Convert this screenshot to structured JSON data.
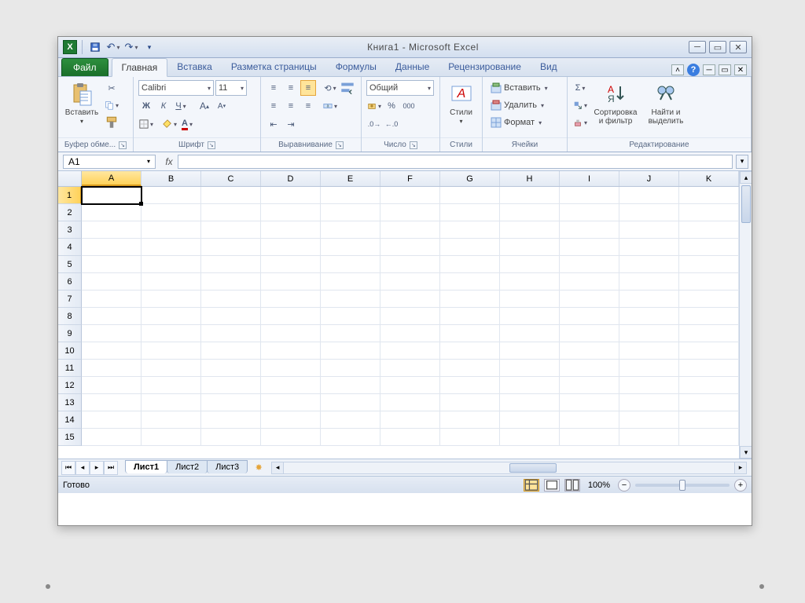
{
  "title": "Книга1  -  Microsoft Excel",
  "tabs": {
    "file": "Файл",
    "list": [
      "Главная",
      "Вставка",
      "Разметка страницы",
      "Формулы",
      "Данные",
      "Рецензирование",
      "Вид"
    ],
    "active": "Главная"
  },
  "groups": {
    "clipboard": {
      "label": "Буфер обме...",
      "paste": "Вставить"
    },
    "font": {
      "label": "Шрифт",
      "name": "Calibri",
      "size": "11"
    },
    "align": {
      "label": "Выравнивание"
    },
    "number": {
      "label": "Число",
      "format": "Общий"
    },
    "styles": {
      "label": "Стили",
      "btn": "Стили"
    },
    "cells": {
      "label": "Ячейки",
      "insert": "Вставить",
      "delete": "Удалить",
      "format": "Формат"
    },
    "editing": {
      "label": "Редактирование",
      "sort": "Сортировка\nи фильтр",
      "find": "Найти и\nвыделить"
    }
  },
  "namebox": "A1",
  "columns": [
    "A",
    "B",
    "C",
    "D",
    "E",
    "F",
    "G",
    "H",
    "I",
    "J",
    "K"
  ],
  "rows": [
    "1",
    "2",
    "3",
    "4",
    "5",
    "6",
    "7",
    "8",
    "9",
    "10",
    "11",
    "12",
    "13",
    "14",
    "15"
  ],
  "activeCell": {
    "col": 0,
    "row": 0
  },
  "sheets": [
    "Лист1",
    "Лист2",
    "Лист3"
  ],
  "activeSheet": "Лист1",
  "status": "Готово",
  "zoom": "100%"
}
